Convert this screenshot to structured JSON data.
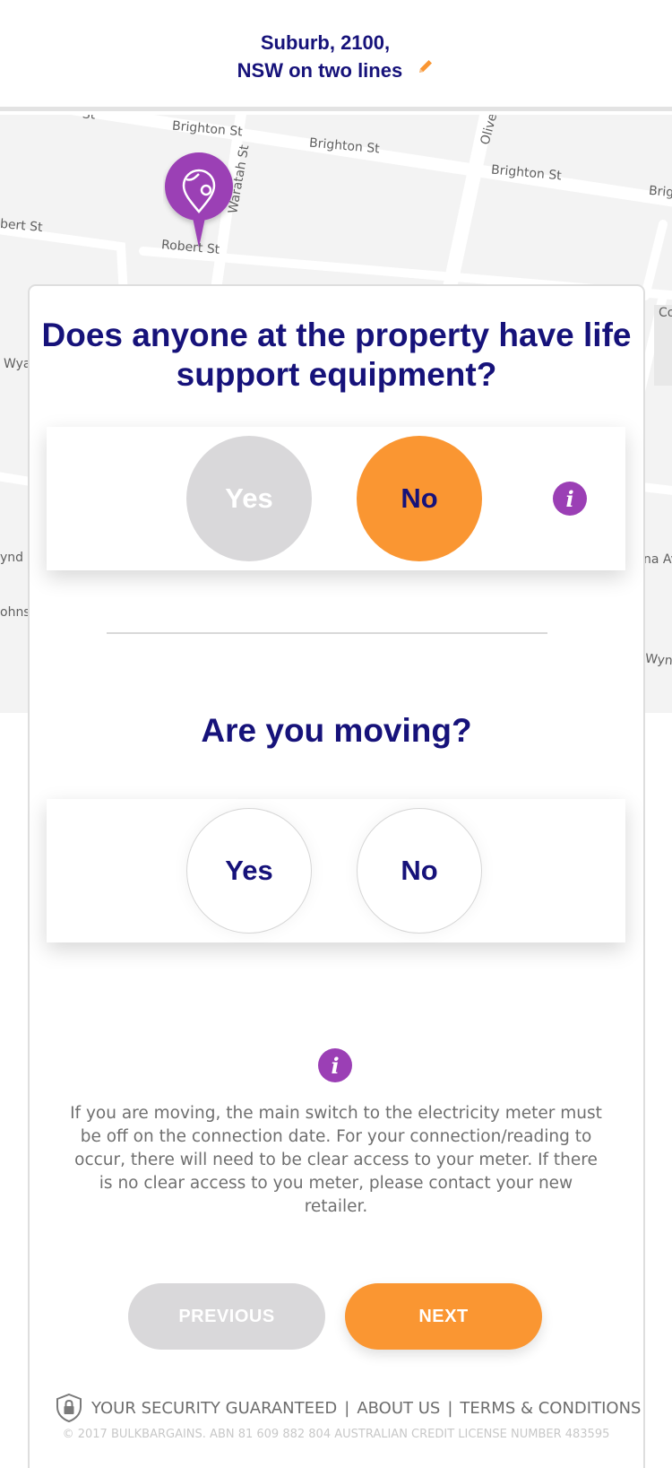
{
  "header": {
    "address_line1": "Suburb, 2100,",
    "address_line2": "NSW on two lines",
    "edit_icon": "pencil-icon"
  },
  "map": {
    "streets": {
      "brighton_1": "Brighton St",
      "brighton_2": "Brighton St",
      "brighton_3": "Brighton St",
      "brighton_4": "Brig",
      "olive": "Olive",
      "waratah": "Waratah St",
      "robert_1": "Robert St",
      "robert_2": "bert St",
      "wya": "Wya",
      "wynd_left": "ynd",
      "johns": "ohns",
      "co": "Co",
      "na_av": "na Av",
      "wyn": "Wyn",
      "fragment_st": "St"
    },
    "pin_icon": "location-pin-icon"
  },
  "questions": {
    "life_support": {
      "title": "Does anyone at the property have life support equipment?",
      "yes_label": "Yes",
      "no_label": "No",
      "selected": "No",
      "info_icon": "info-icon"
    },
    "moving": {
      "title": "Are you moving?",
      "yes_label": "Yes",
      "no_label": "No",
      "selected": ""
    }
  },
  "info": {
    "icon": "info-icon",
    "glyph": "i",
    "text": "If you are moving, the main switch to the electricity meter must be off on the connection date. For your connection/reading to occur, there will need to be clear access to your meter. If there is no clear access to you meter, please contact your new retailer."
  },
  "nav": {
    "previous_label": "PREVIOUS",
    "next_label": "NEXT"
  },
  "footer": {
    "security_label": "YOUR SECURITY GUARANTEED",
    "separator": "|",
    "about_label": "ABOUT US",
    "terms_label": "TERMS & CONDITIONS",
    "shield_icon": "shield-lock-icon",
    "copyright": "© 2017 BULKBARGAINS. ABN 81 609 882 804 AUSTRALIAN CREDIT LICENSE NUMBER 483595"
  },
  "colors": {
    "navy": "#16127a",
    "orange": "#fa9632",
    "purple": "#9b3fb5",
    "grey": "#d9d8da"
  }
}
